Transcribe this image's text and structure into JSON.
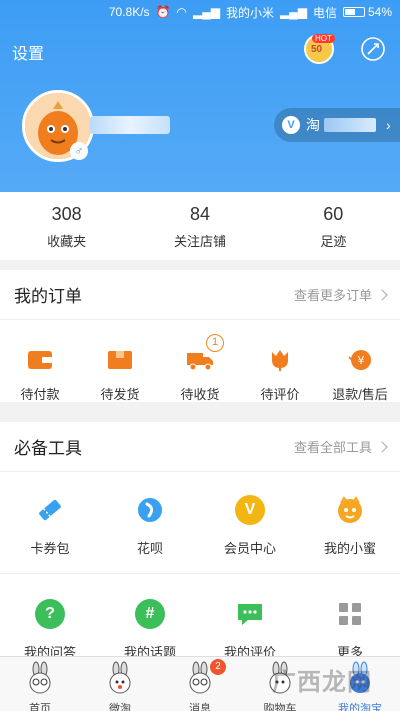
{
  "status_bar": {
    "speed": "70.8K/s",
    "carrier1": "我的小米",
    "carrier2": "电信",
    "battery": "54%",
    "battery_level": 0.54
  },
  "header": {
    "settings_label": "设置",
    "hot_label": "HOT",
    "level": "50",
    "vip_prefix": "淘"
  },
  "stats": [
    {
      "value": "308",
      "label": "收藏夹"
    },
    {
      "value": "84",
      "label": "关注店铺"
    },
    {
      "value": "60",
      "label": "足迹"
    }
  ],
  "orders": {
    "title": "我的订单",
    "more": "查看更多订单",
    "items": [
      {
        "label": "待付款",
        "icon": "wallet-icon"
      },
      {
        "label": "待发货",
        "icon": "package-icon"
      },
      {
        "label": "待收货",
        "icon": "truck-icon",
        "badge": "1"
      },
      {
        "label": "待评价",
        "icon": "flower-icon"
      },
      {
        "label": "退款/售后",
        "icon": "refund-icon"
      }
    ]
  },
  "tools": {
    "title": "必备工具",
    "more": "查看全部工具",
    "row1": [
      {
        "label": "卡券包",
        "icon": "ticket-icon",
        "color": "#3aa0f0"
      },
      {
        "label": "花呗",
        "icon": "huabei-icon",
        "color": "#3aa0f0"
      },
      {
        "label": "会员中心",
        "icon": "vip-icon",
        "color": "#f3b511"
      },
      {
        "label": "我的小蜜",
        "icon": "assistant-icon",
        "color": "#f5a623"
      }
    ],
    "row2": [
      {
        "label": "我的问答",
        "icon": "question-icon",
        "color": "#3cbf5a"
      },
      {
        "label": "我的话题",
        "icon": "hashtag-icon",
        "color": "#3cbf5a"
      },
      {
        "label": "我的评价",
        "icon": "comment-icon",
        "color": "#3cbf5a"
      },
      {
        "label": "更多",
        "icon": "grid-icon",
        "color": "#9a9a9a"
      }
    ]
  },
  "tabbar": [
    {
      "label": "首页"
    },
    {
      "label": "微淘"
    },
    {
      "label": "消息",
      "badge": "2"
    },
    {
      "label": "购物车"
    },
    {
      "label": "我的淘宝"
    }
  ],
  "watermark": "广西龙网"
}
